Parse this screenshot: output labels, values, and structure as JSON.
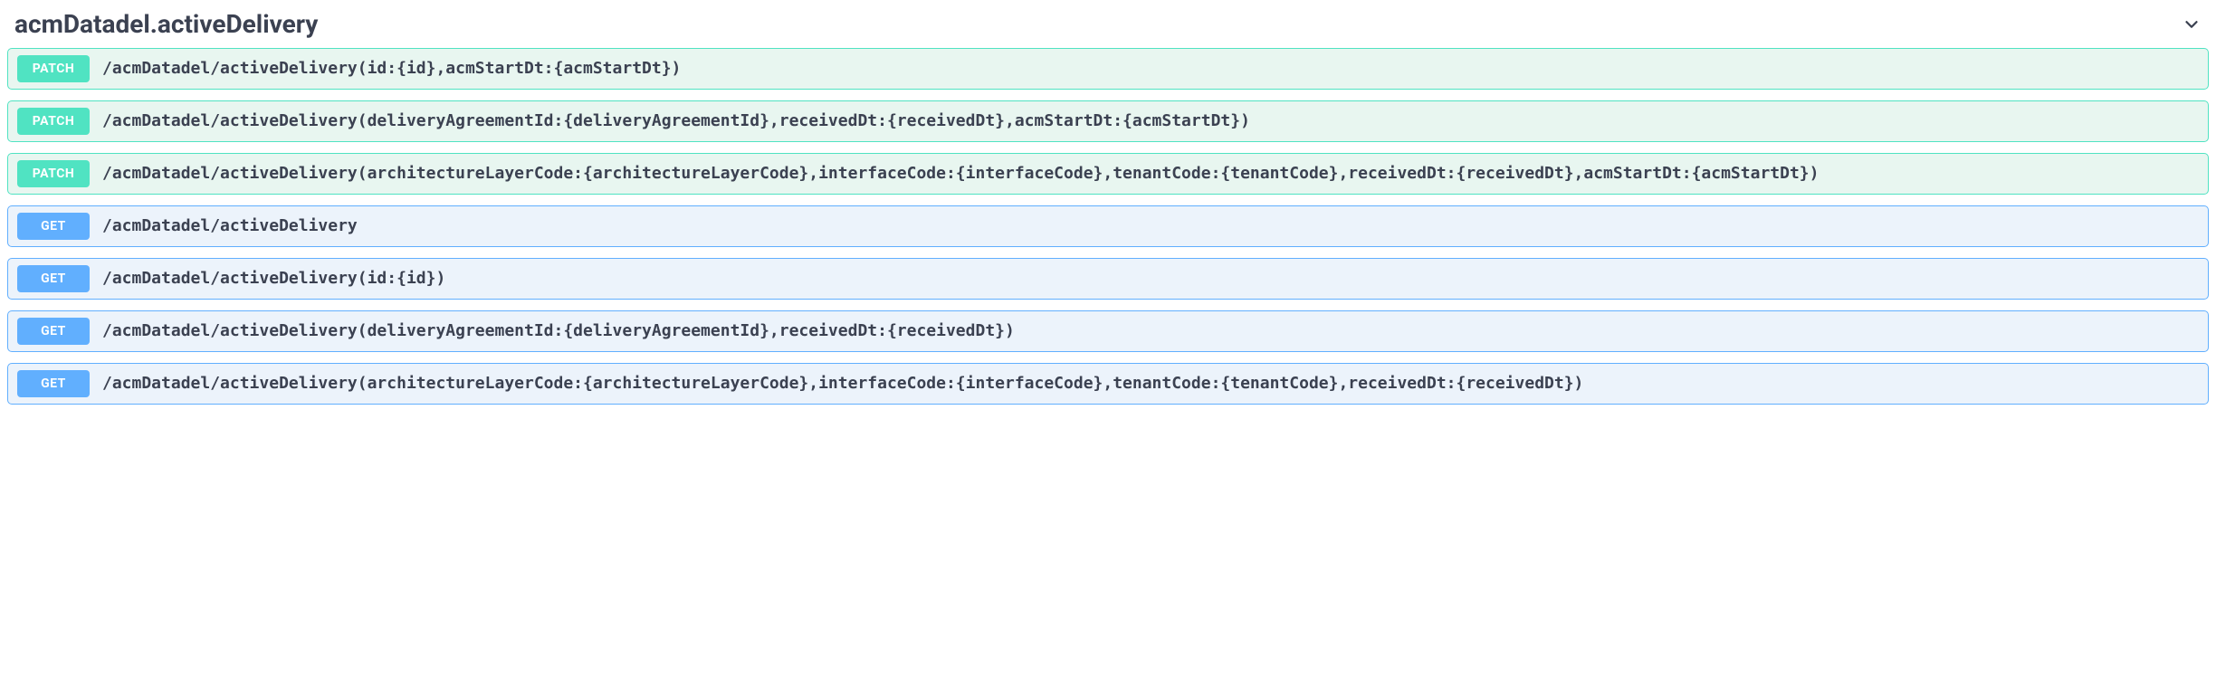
{
  "tag": {
    "name": "acmDatadel.activeDelivery"
  },
  "operations": [
    {
      "method": "PATCH",
      "class": "patch",
      "path": "/acmDatadel/activeDelivery(id:{id},acmStartDt:{acmStartDt})"
    },
    {
      "method": "PATCH",
      "class": "patch",
      "path": "/acmDatadel/activeDelivery(deliveryAgreementId:{deliveryAgreementId},receivedDt:{receivedDt},acmStartDt:{acmStartDt})"
    },
    {
      "method": "PATCH",
      "class": "patch",
      "path": "/acmDatadel/activeDelivery(architectureLayerCode:{architectureLayerCode},interfaceCode:{interfaceCode},tenantCode:{tenantCode},receivedDt:{receivedDt},acmStartDt:{acmStartDt})"
    },
    {
      "method": "GET",
      "class": "get",
      "path": "/acmDatadel/activeDelivery"
    },
    {
      "method": "GET",
      "class": "get",
      "path": "/acmDatadel/activeDelivery(id:{id})"
    },
    {
      "method": "GET",
      "class": "get",
      "path": "/acmDatadel/activeDelivery(deliveryAgreementId:{deliveryAgreementId},receivedDt:{receivedDt})"
    },
    {
      "method": "GET",
      "class": "get",
      "path": "/acmDatadel/activeDelivery(architectureLayerCode:{architectureLayerCode},interfaceCode:{interfaceCode},tenantCode:{tenantCode},receivedDt:{receivedDt})"
    }
  ]
}
